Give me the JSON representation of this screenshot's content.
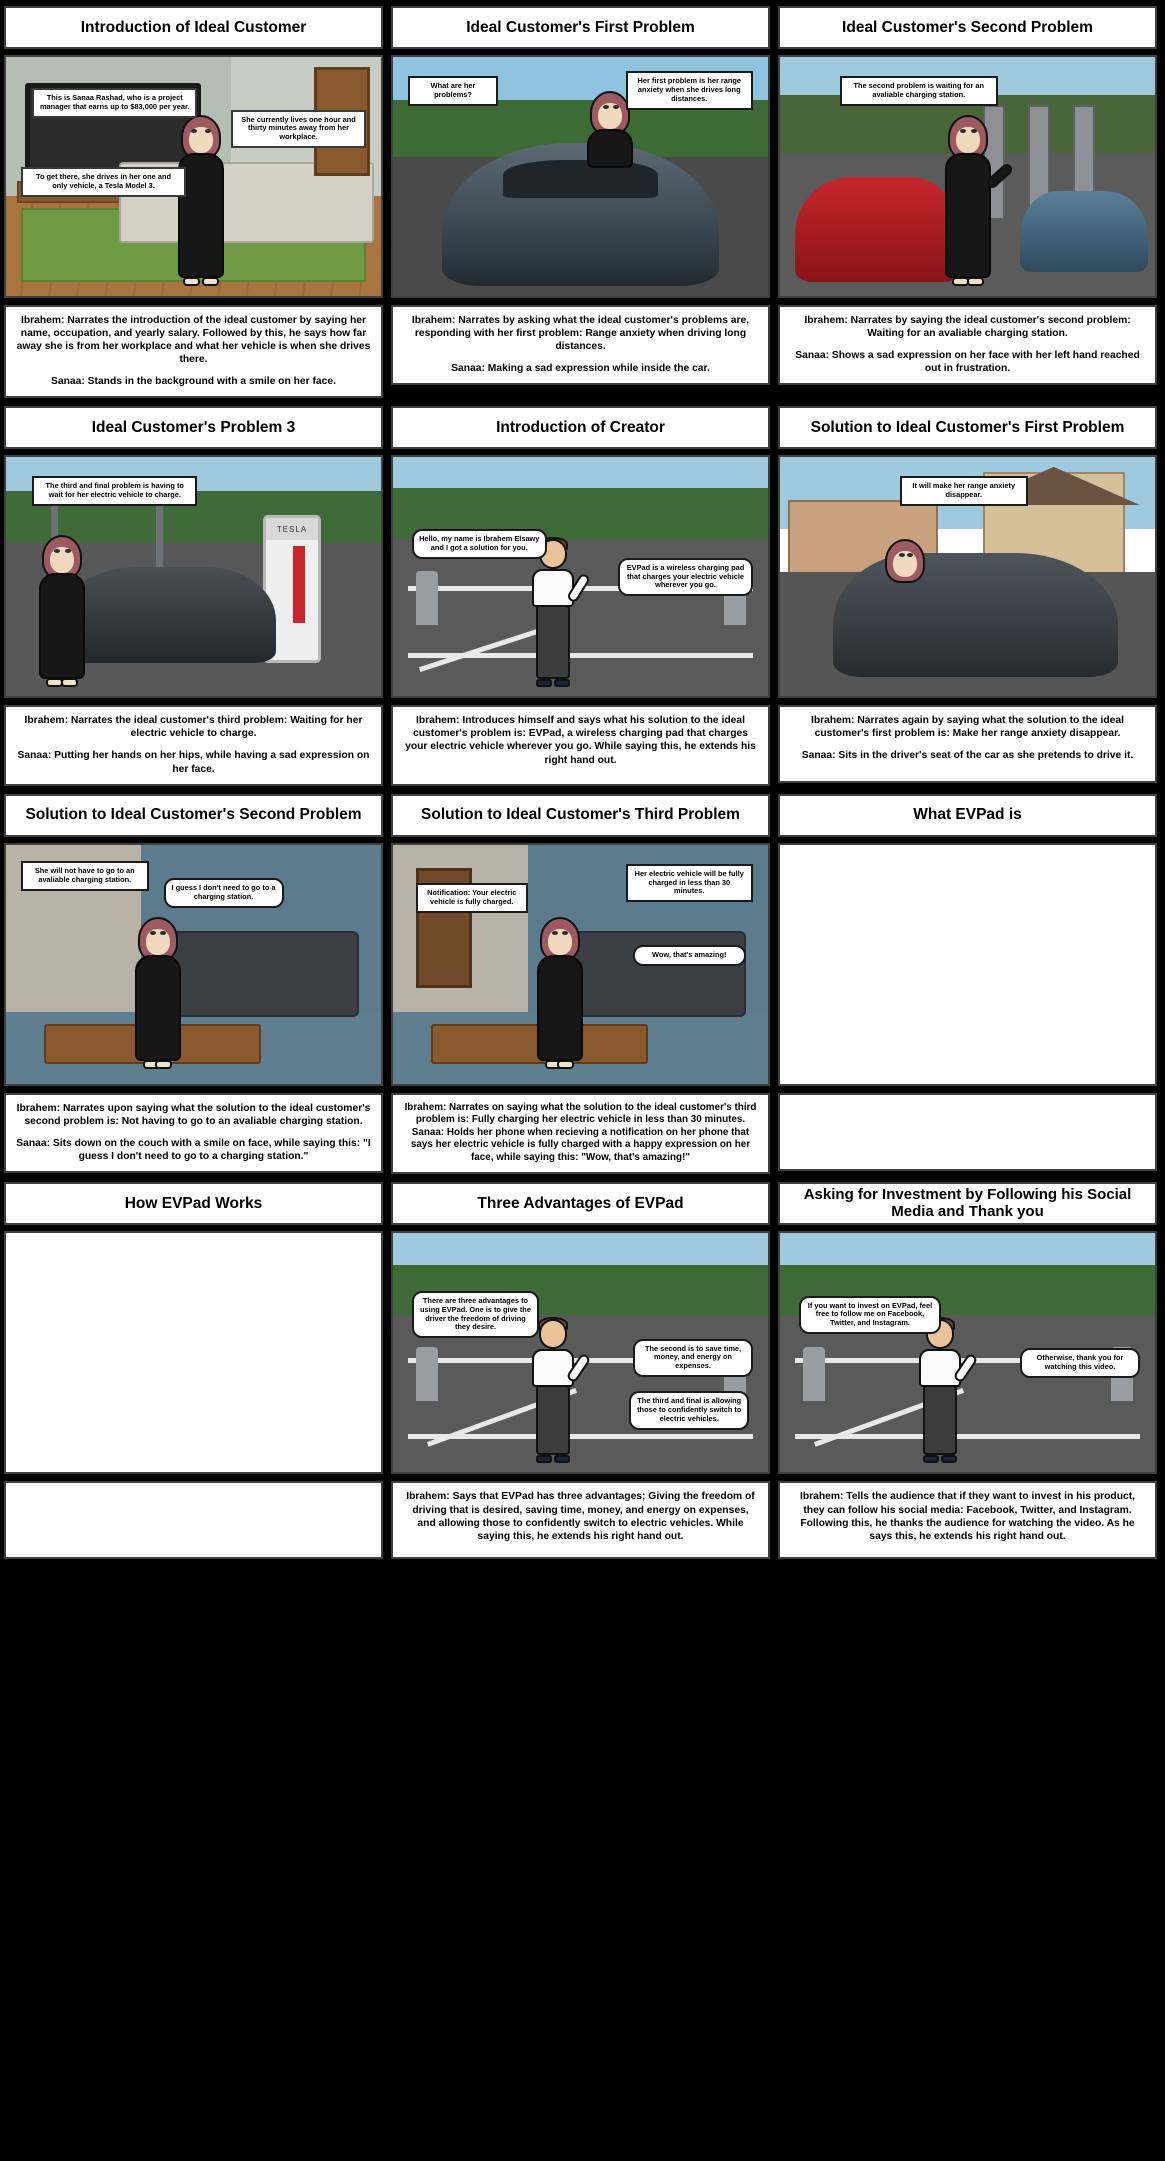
{
  "document": {
    "type": "storyboard",
    "columns": 3,
    "rows": 5,
    "background_color": "#000000",
    "panel_bg": "#ffffff"
  },
  "cells": [
    {
      "id": "cell-1",
      "title": "Introduction of Ideal Customer",
      "scene": "living-room",
      "bubbles": [
        "This is Sanaa Rashad, who is a project manager that earns up to $83,000 per year.",
        "She currently lives one hour and thirty minutes away from her workplace.",
        "To get there, she drives in her one and only vehicle, a Tesla Model 3."
      ],
      "caption_narrator": "Ibrahem: Narrates the introduction of the ideal customer by saying her name, occupation, and yearly salary. Followed by this, he says how far away she is from her workplace and what her vehicle is when she drives there.",
      "caption_action": "Sanaa: Stands in the background with a smile on her face."
    },
    {
      "id": "cell-2",
      "title": "Ideal Customer's First Problem",
      "scene": "road-tesla",
      "bubbles": [
        "What are her problems?",
        "Her first problem is her range anxiety when she drives long distances."
      ],
      "caption_narrator": "Ibrahem: Narrates by asking what the ideal customer's problems are, responding with her first problem: Range anxiety when driving long distances.",
      "caption_action": "Sanaa: Making a sad expression while inside the car."
    },
    {
      "id": "cell-3",
      "title": "Ideal Customer's Second Problem",
      "scene": "charging-station",
      "bubbles": [
        "The second problem is waiting for an avaliable charging station."
      ],
      "caption_narrator": "Ibrahem: Narrates by saying the ideal customer's second problem: Waiting for an avaliable charging station.",
      "caption_action": "Sanaa: Shows a sad expression on her face with her left hand reached out in frustration."
    },
    {
      "id": "cell-4",
      "title": "Ideal Customer's Problem 3",
      "scene": "supercharger",
      "bubbles": [
        "The third and final problem is having to wait for her electric vehicle to charge."
      ],
      "caption_narrator": "Ibrahem: Narrates the ideal customer's third problem: Waiting for her electric vehicle to charge.",
      "caption_action": "Sanaa: Putting her hands on her hips, while having a sad expression on her face."
    },
    {
      "id": "cell-5",
      "title": "Introduction of Creator",
      "scene": "parking-lot",
      "bubbles": [
        "Hello, my name is Ibrahem Elsawy and I got a solution for you.",
        "EVPad is a wireless charging pad that charges your electric vehicle wherever you go."
      ],
      "caption_narrator": "Ibrahem: Introduces himself and says what his solution to the ideal customer's problem is: EVPad, a wireless charging pad that charges your electric vehicle wherever you go. While saying this, he extends his right hand out.",
      "caption_action": ""
    },
    {
      "id": "cell-6",
      "title": "Solution to Ideal Customer's First Problem",
      "scene": "neighborhood",
      "bubbles": [
        "It will make her range anxiety disappear."
      ],
      "caption_narrator": "Ibrahem: Narrates again by saying what the solution to the ideal customer's first problem is: Make her range anxiety disappear.",
      "caption_action": "Sanaa: Sits in the driver's seat of the car as she pretends to drive it."
    },
    {
      "id": "cell-7",
      "title": "Solution to Ideal Customer's Second Problem",
      "scene": "interior-a",
      "bubbles": [
        "She will not have to go to an avaliable charging station.",
        "I guess I don't need to go to a charging station."
      ],
      "caption_narrator": "Ibrahem: Narrates upon saying what the solution to the ideal customer's second problem is: Not having to go to an avaliable charging station.",
      "caption_action": "Sanaa: Sits down on the couch with a smile on face, while saying this: \"I guess I don't need to go to a charging station.\""
    },
    {
      "id": "cell-8",
      "title": "Solution to Ideal Customer's Third Problem",
      "scene": "interior-b",
      "bubbles": [
        "Notification: Your electric vehicle is fully charged.",
        "Her electric vehicle will be fully charged in less than 30 minutes.",
        "Wow, that's amazing!"
      ],
      "caption_narrator": "Ibrahem: Narrates on saying what the solution to the ideal customer's third problem is: Fully charging her electric vehicle in less than 30 minutes.",
      "caption_action": "Sanaa: Holds her phone when recieving a notification on her phone that says her electric vehicle is fully charged with a happy expression on her face, while saying this: \"Wow, that's amazing!\""
    },
    {
      "id": "cell-9",
      "title": "What EVPad is",
      "scene": "blank",
      "bubbles": [],
      "caption_narrator": "",
      "caption_action": ""
    },
    {
      "id": "cell-10",
      "title": "How EVPad Works",
      "scene": "blank",
      "bubbles": [],
      "caption_narrator": "",
      "caption_action": ""
    },
    {
      "id": "cell-11",
      "title": "Three Advantages of EVPad",
      "scene": "parking-lot",
      "bubbles": [
        "There are three advantages to using EVPad. One is to give the driver the freedom of driving they desire.",
        "The second is to save time, money, and energy on expenses.",
        "The third and final is allowing those to confidently switch to electric vehicles."
      ],
      "caption_narrator": "Ibrahem: Says that EVPad has three advantages; Giving the freedom of driving that is desired, saving time, money, and energy on expenses, and allowing those to confidently switch to electric vehicles. While saying this, he extends his right hand out.",
      "caption_action": ""
    },
    {
      "id": "cell-12",
      "title": "Asking for Investment by Following his Social Media and Thank you",
      "scene": "parking-lot",
      "bubbles": [
        "If you want to invest on EVPad, feel free to follow me on Facebook, Twitter, and Instagram.",
        "Otherwise, thank you for watching this video."
      ],
      "caption_narrator": "Ibrahem: Tells the audience that if they want to invest in his product, they can follow his social media: Facebook, Twitter, and Instagram. Following this, he thanks the audience for watching the video. As he says this, he extends his right hand out.",
      "caption_action": ""
    }
  ],
  "labels": {
    "tesla_brand": "TESLA"
  }
}
